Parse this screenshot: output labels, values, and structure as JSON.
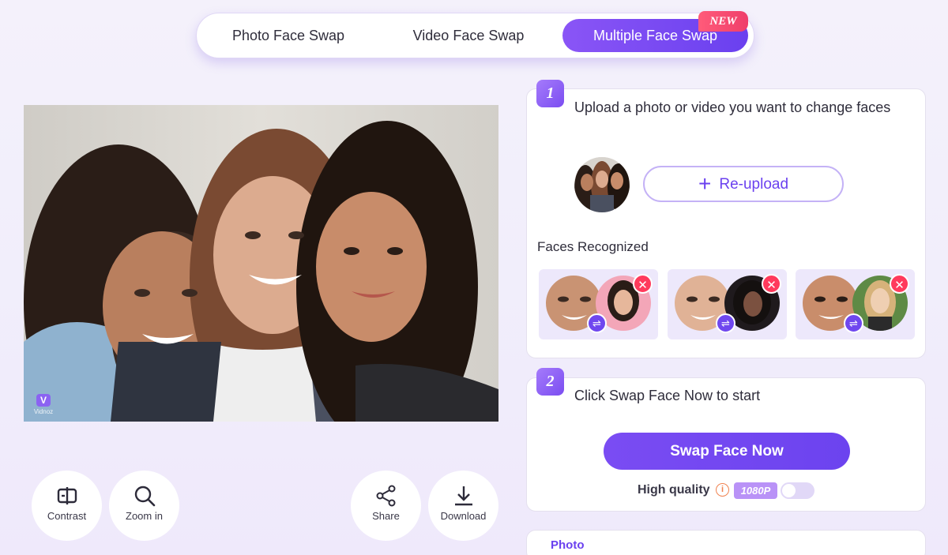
{
  "tabs": {
    "photo": "Photo Face Swap",
    "video": "Video Face Swap",
    "multiple": "Multiple Face Swap",
    "new_badge": "NEW"
  },
  "watermark": {
    "logo": "V",
    "text": "Vidnoz"
  },
  "tools": {
    "contrast": "Contrast",
    "zoom": "Zoom in",
    "share": "Share",
    "download": "Download"
  },
  "step1": {
    "number": "1",
    "title": "Upload a photo or video you want to change faces",
    "reupload": "Re-upload",
    "faces_label": "Faces Recognized",
    "remove_symbol": "✕",
    "swap_symbol": "⇌"
  },
  "step2": {
    "number": "2",
    "title": "Click Swap Face Now to start",
    "button": "Swap Face Now",
    "quality_label": "High quality",
    "info_symbol": "i",
    "resolution": "1080P"
  },
  "step3": {
    "title": "Photo"
  },
  "colors": {
    "accent": "#6c43ef",
    "new_badge": "#ef3e6a",
    "remove": "#ff3a5c",
    "resolution_badge": "#b992f7"
  }
}
